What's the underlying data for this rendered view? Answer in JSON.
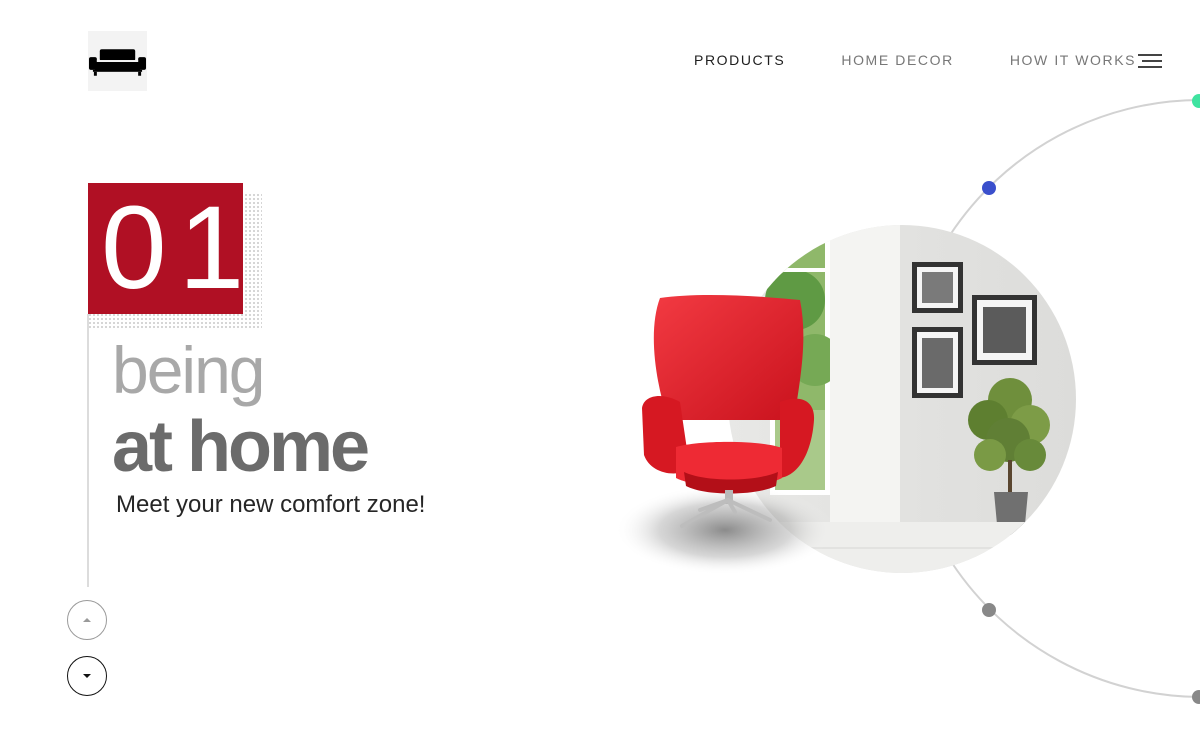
{
  "nav": {
    "items": [
      {
        "label": "PRODUCTS",
        "active": true
      },
      {
        "label": "HOME DECOR",
        "active": false
      },
      {
        "label": "HOW IT WORKS",
        "active": false
      }
    ]
  },
  "icons": {
    "logo": "sofa-icon",
    "menu": "hamburger-menu-icon",
    "prev": "arrow-up-icon",
    "next": "arrow-down-icon"
  },
  "hero": {
    "number": "01",
    "headline_light": "being",
    "headline_bold": "at home",
    "tagline": "Meet your new comfort zone!"
  },
  "colors": {
    "accent": "#b01024",
    "chair": "#e3202c",
    "dot_green": "#3fe3a0",
    "dot_blue": "#3a4fcc",
    "dot_gray": "#888888"
  }
}
